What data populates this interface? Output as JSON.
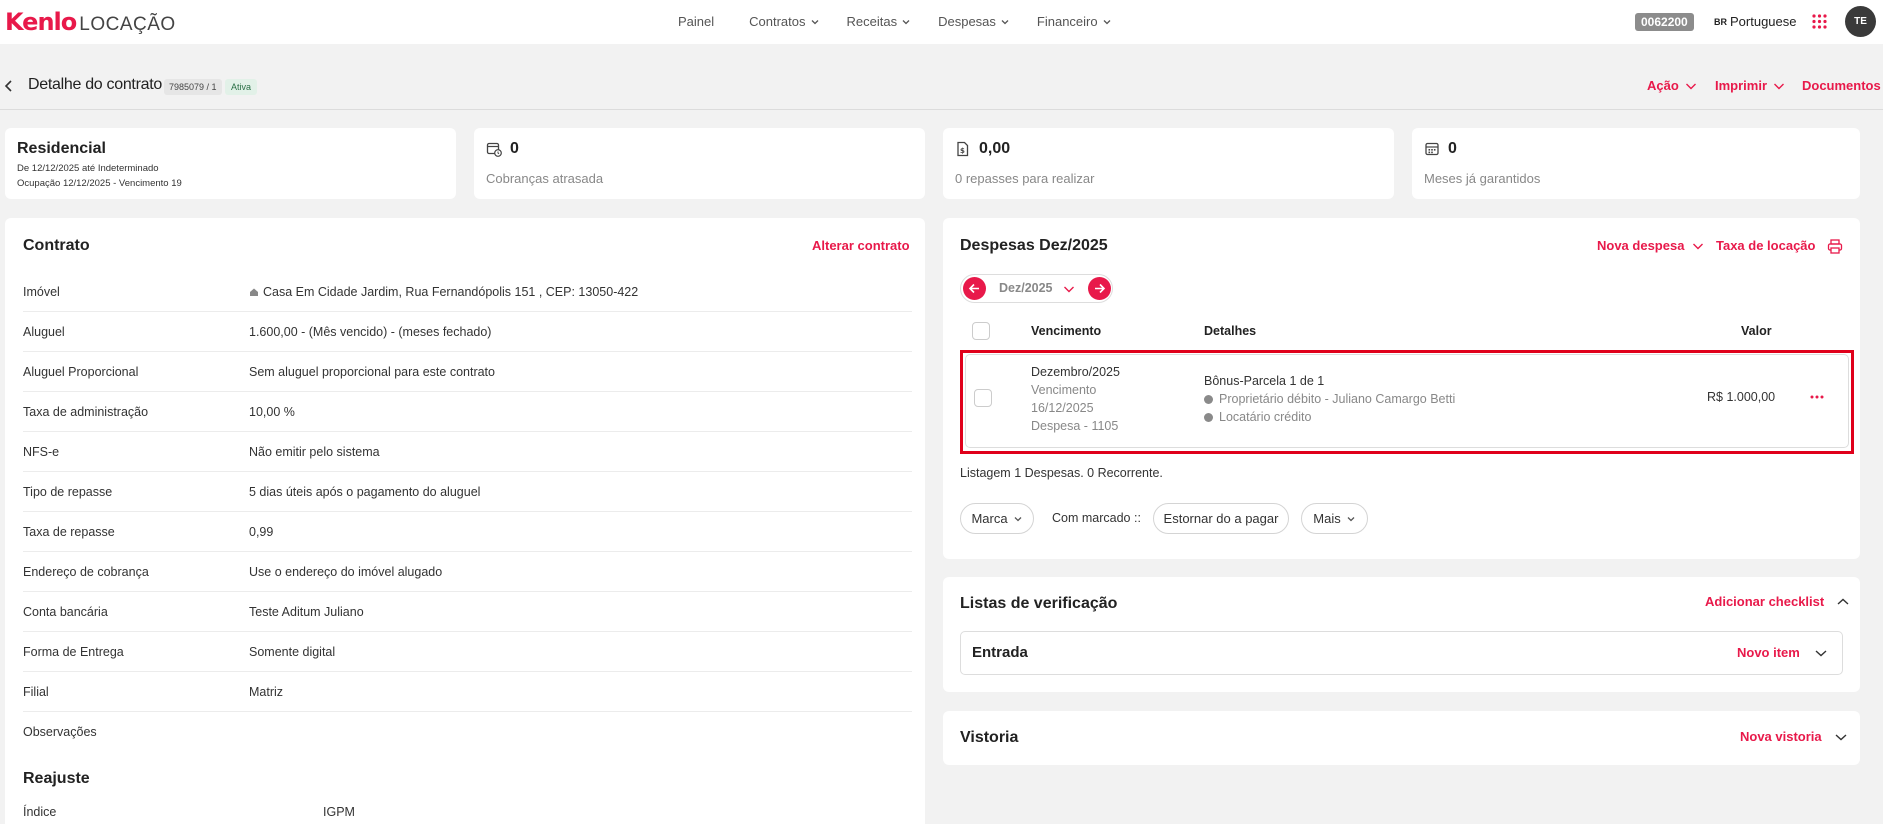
{
  "app": {
    "logo_main": "Kenlo",
    "logo_sub": "LOCAÇÃO"
  },
  "nav": {
    "items": [
      {
        "label": "Painel"
      },
      {
        "label": "Contratos"
      },
      {
        "label": "Receitas"
      },
      {
        "label": "Despesas"
      },
      {
        "label": "Financeiro"
      }
    ],
    "code": "0062200",
    "lang_flag": "BR",
    "lang": "Portuguese",
    "avatar": "TE"
  },
  "header": {
    "title": "Detalhe do contrato",
    "contract_id": "7985079 / 1",
    "status": "Ativa",
    "actions": [
      "Ação",
      "Imprimir",
      "Documentos"
    ]
  },
  "summary": {
    "type": "Residencial",
    "period": "De 12/12/2025 até Indeterminado",
    "occupancy": "Ocupação 12/12/2025 - Vencimento 19",
    "overdue_value": "0",
    "overdue_label": "Cobranças atrasada",
    "transfers_value": "0,00",
    "transfers_label": "0 repasses para realizar",
    "guaranteed_value": "0",
    "guaranteed_label": "Meses já garantidos"
  },
  "contract": {
    "title": "Contrato",
    "edit_link": "Alterar contrato",
    "rows": [
      {
        "label": "Imóvel",
        "value": "Casa Em Cidade Jardim, Rua Fernandópolis 151 , CEP: 13050-422"
      },
      {
        "label": "Aluguel",
        "value": "1.600,00 - (Mês vencido) - (meses fechado)"
      },
      {
        "label": "Aluguel Proporcional",
        "value": "Sem aluguel proporcional para este contrato"
      },
      {
        "label": "Taxa de administração",
        "value": "10,00 %"
      },
      {
        "label": "NFS-e",
        "value": "Não emitir pelo sistema"
      },
      {
        "label": "Tipo de repasse",
        "value": "5 dias úteis após o pagamento do aluguel"
      },
      {
        "label": "Taxa de repasse",
        "value": "0,99"
      },
      {
        "label": "Endereço de cobrança",
        "value": "Use o endereço do imóvel alugado"
      },
      {
        "label": "Conta bancária",
        "value": "Teste Aditum Juliano"
      },
      {
        "label": "Forma de Entrega",
        "value": "Somente digital"
      },
      {
        "label": "Filial",
        "value": "Matriz"
      },
      {
        "label": "Observações",
        "value": ""
      }
    ],
    "adjustment_title": "Reajuste",
    "index_label": "Índice",
    "index_value": "IGPM"
  },
  "expenses": {
    "title": "Despesas Dez/2025",
    "new_expense": "Nova despesa",
    "rental_fee": "Taxa de locação",
    "month": "Dez/2025",
    "columns": [
      "Vencimento",
      "Detalhes",
      "Valor"
    ],
    "item": {
      "month": "Dezembro/2025",
      "due_label": "Vencimento",
      "due_date": "16/12/2025",
      "expense_no": "Despesa - 1105",
      "title": "Bônus-Parcela 1 de 1",
      "owner": "Proprietário débito - Juliano Camargo Betti",
      "tenant": "Locatário crédito",
      "amount": "R$ 1.000,00"
    },
    "summary": "Listagem 1 Despesas. 0 Recorrente.",
    "mark_btn": "Marca",
    "with_marked": "Com marcado ::",
    "reverse_btn": "Estornar do a pagar",
    "more_btn": "Mais"
  },
  "checklists": {
    "title": "Listas de verificação",
    "add": "Adicionar checklist",
    "entry_title": "Entrada",
    "new_item": "Novo item"
  },
  "inspection": {
    "title": "Vistoria",
    "new": "Nova vistoria"
  },
  "colors": {
    "accent": "#e8194a",
    "highlight": "#e0001b"
  }
}
